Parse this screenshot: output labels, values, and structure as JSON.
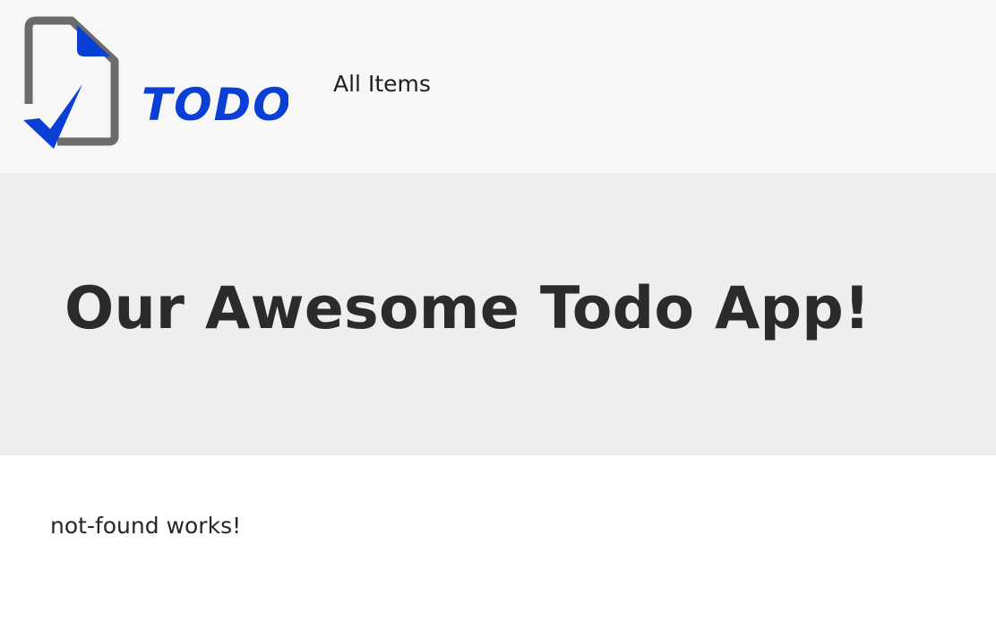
{
  "navbar": {
    "brand": {
      "logo_text": "TODO",
      "colors": {
        "page_outline": "#6b6b6b",
        "accent_blue": "#0a3fd6"
      }
    },
    "links": [
      {
        "label": "All Items"
      }
    ]
  },
  "jumbotron": {
    "title": "Our Awesome Todo App!"
  },
  "main": {
    "message": "not-found works!"
  }
}
